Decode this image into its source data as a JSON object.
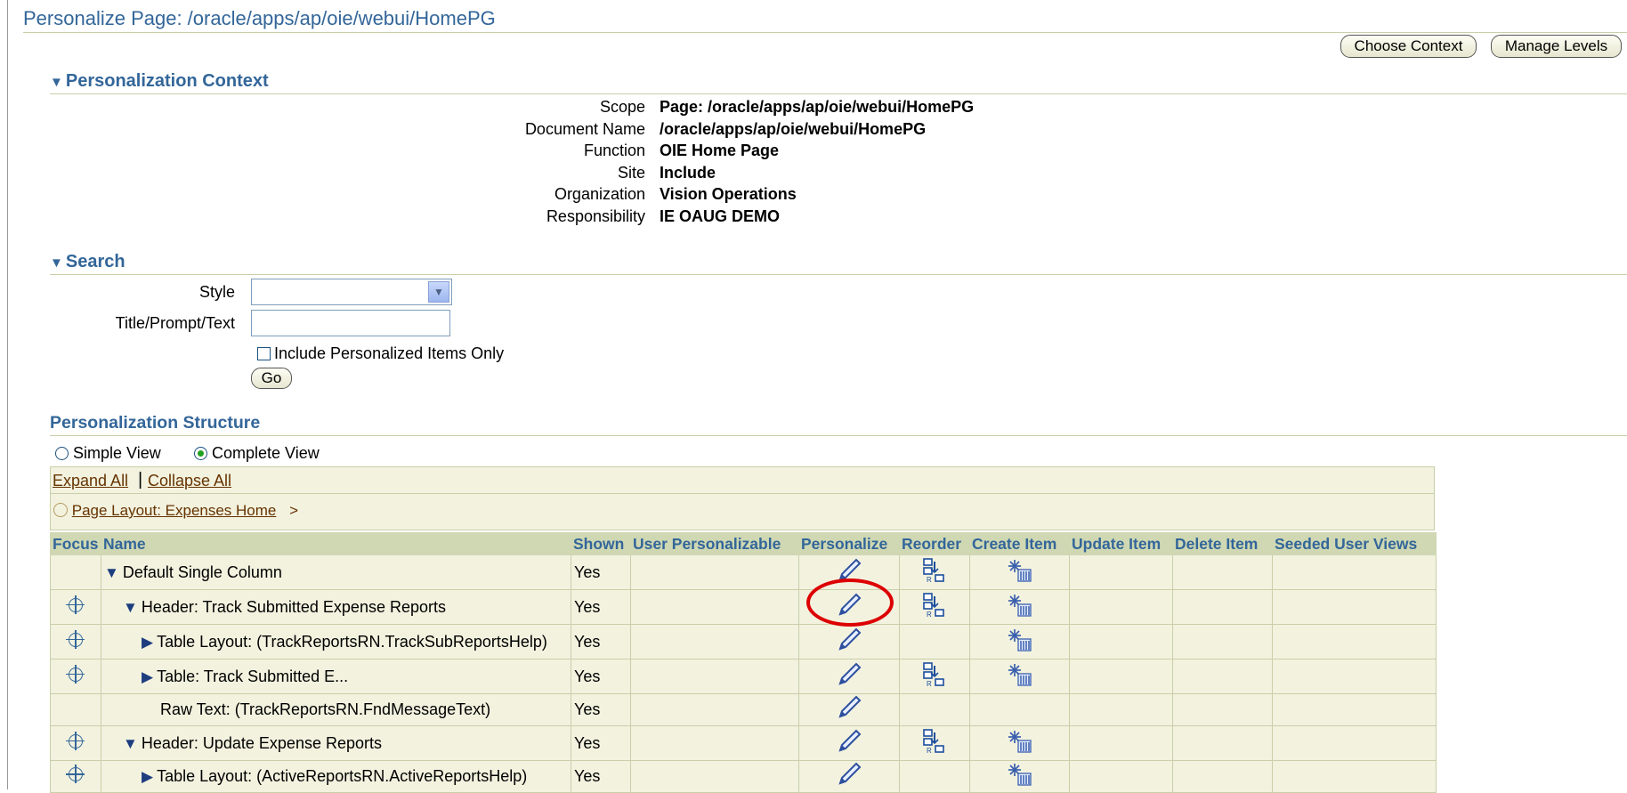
{
  "page": {
    "title": "Personalize Page: /oracle/apps/ap/oie/webui/HomePG"
  },
  "buttons": {
    "choose_context": "Choose Context",
    "manage_levels": "Manage Levels",
    "go": "Go"
  },
  "context": {
    "header": "Personalization Context",
    "rows": [
      {
        "label": "Scope",
        "value": "Page: /oracle/apps/ap/oie/webui/HomePG"
      },
      {
        "label": "Document Name",
        "value": "/oracle/apps/ap/oie/webui/HomePG"
      },
      {
        "label": "Function",
        "value": "OIE Home Page"
      },
      {
        "label": "Site",
        "value": "Include"
      },
      {
        "label": "Organization",
        "value": "Vision Operations"
      },
      {
        "label": "Responsibility",
        "value": "IE OAUG DEMO"
      }
    ]
  },
  "search": {
    "header": "Search",
    "style_label": "Style",
    "style_value": "",
    "text_label": "Title/Prompt/Text",
    "text_value": "",
    "checkbox_label": "Include Personalized Items Only",
    "checkbox_checked": false
  },
  "structure": {
    "header": "Personalization Structure",
    "view_simple": "Simple View",
    "view_complete": "Complete View",
    "selected_view": "Complete View",
    "expand_all": "Expand All",
    "separator": "|",
    "collapse_all": "Collapse All",
    "breadcrumb": "Page Layout: Expenses Home",
    "breadcrumb_arrow": ">",
    "columns": [
      "Focus",
      "Name",
      "Shown",
      "User Personalizable",
      "Personalize",
      "Reorder",
      "Create Item",
      "Update Item",
      "Delete Item",
      "Seeded User Views"
    ],
    "rows": [
      {
        "name": "Default Single Column",
        "indent": 0,
        "toggle": "expanded",
        "focus": false,
        "shown": "Yes",
        "personalize": true,
        "reorder": true,
        "create": true
      },
      {
        "name": "Header: Track Submitted Expense Reports",
        "indent": 1,
        "toggle": "expanded",
        "focus": true,
        "shown": "Yes",
        "personalize": true,
        "reorder": true,
        "create": true
      },
      {
        "name": "Table Layout: (TrackReportsRN.TrackSubReportsHelp)",
        "indent": 2,
        "toggle": "collapsed",
        "focus": true,
        "shown": "Yes",
        "personalize": true,
        "reorder": false,
        "create": true
      },
      {
        "name": "Table: Track Submitted E...",
        "indent": 2,
        "toggle": "collapsed",
        "focus": true,
        "shown": "Yes",
        "personalize": true,
        "reorder": true,
        "create": true
      },
      {
        "name": "Raw Text: (TrackReportsRN.FndMessageText)",
        "indent": 3,
        "toggle": "none",
        "focus": false,
        "shown": "Yes",
        "personalize": true,
        "reorder": false,
        "create": false
      },
      {
        "name": "Header: Update Expense Reports",
        "indent": 1,
        "toggle": "expanded",
        "focus": true,
        "shown": "Yes",
        "personalize": true,
        "reorder": true,
        "create": true
      },
      {
        "name": "Table Layout: (ActiveReportsRN.ActiveReportsHelp)",
        "indent": 2,
        "toggle": "collapsed",
        "focus": true,
        "shown": "Yes",
        "personalize": true,
        "reorder": false,
        "create": true
      }
    ]
  },
  "colors": {
    "accent": "#336699",
    "header_bg": "#cfd8b3",
    "row_bg": "#f2f2df",
    "link": "#663300",
    "annotation": "#dd0000"
  }
}
